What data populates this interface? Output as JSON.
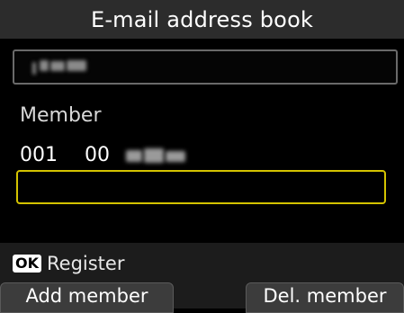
{
  "header": {
    "title": "E-mail address book"
  },
  "group_name": {
    "redacted": true
  },
  "member_section": {
    "label": "Member",
    "entry": {
      "number": "001",
      "type_code": "00",
      "name_redacted": true
    }
  },
  "address_input": {
    "value": "",
    "highlight_color": "#d4c300"
  },
  "footer": {
    "ok_key": "OK",
    "ok_label": "Register",
    "left_button": "Add member",
    "right_button": "Del. member"
  }
}
